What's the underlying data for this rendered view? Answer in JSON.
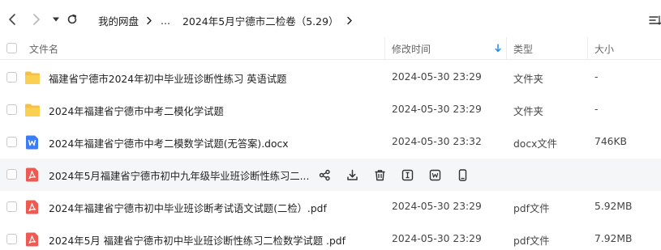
{
  "breadcrumb": {
    "root": "我的网盘",
    "ellipsis": "...",
    "current": "2024年5月宁德市二检卷（5.29）"
  },
  "columns": {
    "name": "文件名",
    "modified": "修改时间",
    "type": "类型",
    "size": "大小"
  },
  "files": [
    {
      "name": "福建省宁德市2024年初中毕业班诊断性练习 英语试题",
      "modified": "2024-05-30 23:29",
      "type": "文件夹",
      "size": "-",
      "icon": "folder-icon"
    },
    {
      "name": "2024年福建省宁德市中考二模化学试题",
      "modified": "2024-05-30 23:29",
      "type": "文件夹",
      "size": "-",
      "icon": "folder-icon"
    },
    {
      "name": "2024年福建省宁德市中考二模数学试题(无答案).docx",
      "modified": "2024-05-30 23:32",
      "type": "docx文件",
      "size": "746KB",
      "icon": "word-doc-icon"
    },
    {
      "name": "2024年5月福建省宁德市初中九年级毕业班诊断性练习二...",
      "modified": "",
      "type": "",
      "size": "",
      "icon": "pdf-icon"
    },
    {
      "name": "2024年福建省宁德市初中毕业班诊断考试语文试题(二检）.pdf",
      "modified": "2024-05-30 23:29",
      "type": "pdf文件",
      "size": "5.92MB",
      "icon": "pdf-icon"
    },
    {
      "name": "2024年5月 福建省宁德市初中毕业班诊断性练习二检数学试题 .pdf",
      "modified": "2024-05-30 23:29",
      "type": "pdf文件",
      "size": "7.92MB",
      "icon": "pdf-icon"
    }
  ],
  "colors": {
    "folder": "#f6c142",
    "word": "#3c7cf6",
    "pdf": "#ee5a52",
    "sort_arrow": "#1f8ff0",
    "hover_row": "#f5f6f8"
  },
  "row_actions": [
    "share-icon",
    "download-icon",
    "delete-icon",
    "rename-icon",
    "open-with-icon",
    "phone-icon"
  ]
}
